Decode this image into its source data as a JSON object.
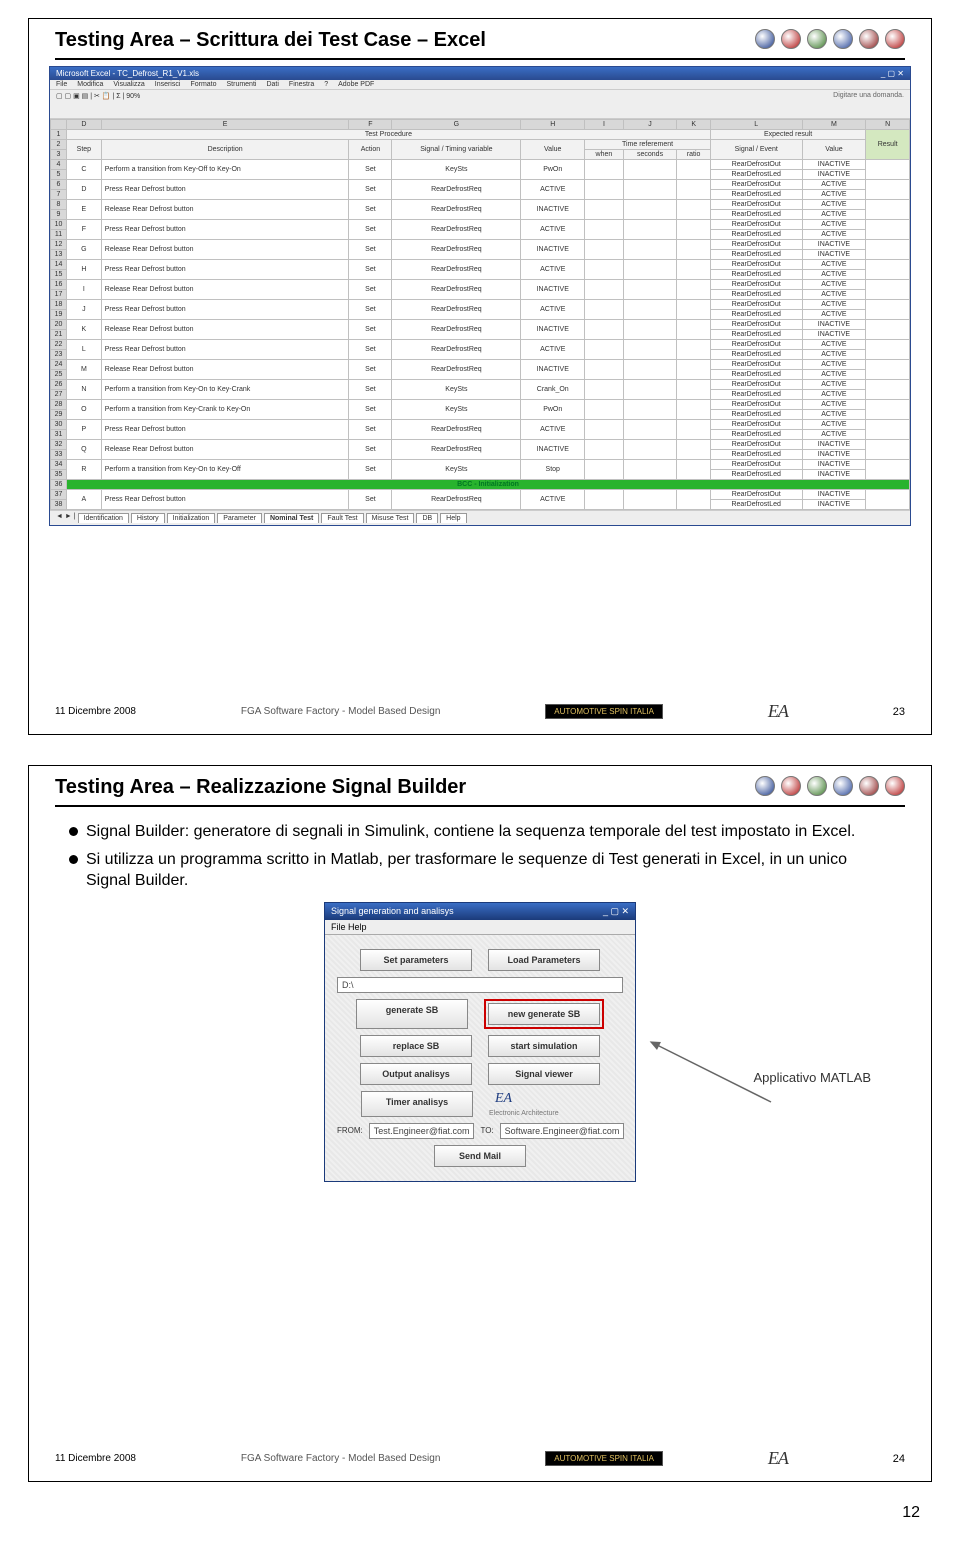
{
  "slide23": {
    "title": "Testing Area – Scrittura dei Test Case – Excel",
    "excel": {
      "window_title": "Microsoft Excel - TC_Defrost_R1_V1.xls",
      "menus": [
        "File",
        "Modifica",
        "Visualizza",
        "Inserisci",
        "Formato",
        "Strumenti",
        "Dati",
        "Finestra",
        "?",
        "Adobe PDF"
      ],
      "question_prompt": "Digitare una domanda.",
      "columns_letters": [
        "D",
        "E",
        "F",
        "G",
        "H",
        "I",
        "J",
        "K",
        "L",
        "M",
        "N"
      ],
      "header1": {
        "test_procedure": "Test Procedure",
        "expected_result": "Expected result",
        "result_col": "Result"
      },
      "header2": {
        "step": "Step",
        "description": "Description",
        "action": "Action",
        "signal_timing": "Signal / Timing variable",
        "value": "Value",
        "time_referement": "Time referement",
        "when": "when",
        "seconds": "seconds",
        "ratio": "ratio",
        "signal_event": "Signal / Event",
        "value2": "Value"
      },
      "expected_pair": [
        {
          "sig": "RearDefrostOut",
          "val": "INACTIVE"
        },
        {
          "sig": "RearDefrostLed",
          "val": "INACTIVE"
        }
      ],
      "expected_active": [
        {
          "sig": "RearDefrostOut",
          "val": "ACTIVE"
        },
        {
          "sig": "RearDefrostLed",
          "val": "ACTIVE"
        }
      ],
      "rows": [
        {
          "step": "C",
          "desc": "Perform a transition from Key-Off to Key-On",
          "action": "Set",
          "sig": "KeySts",
          "val": "PwOn",
          "exp": "inactive"
        },
        {
          "step": "D",
          "desc": "Press Rear Defrost button",
          "action": "Set",
          "sig": "RearDefrostReq",
          "val": "ACTIVE",
          "exp": "active"
        },
        {
          "step": "E",
          "desc": "Release Rear Defrost button",
          "action": "Set",
          "sig": "RearDefrostReq",
          "val": "INACTIVE",
          "exp": "active"
        },
        {
          "step": "F",
          "desc": "Press Rear Defrost button",
          "action": "Set",
          "sig": "RearDefrostReq",
          "val": "ACTIVE",
          "exp": "active"
        },
        {
          "step": "G",
          "desc": "Release Rear Defrost button",
          "action": "Set",
          "sig": "RearDefrostReq",
          "val": "INACTIVE",
          "exp": "inactive"
        },
        {
          "step": "H",
          "desc": "Press Rear Defrost button",
          "action": "Set",
          "sig": "RearDefrostReq",
          "val": "ACTIVE",
          "exp": "active"
        },
        {
          "step": "I",
          "desc": "Release Rear Defrost button",
          "action": "Set",
          "sig": "RearDefrostReq",
          "val": "INACTIVE",
          "exp": "active"
        },
        {
          "step": "J",
          "desc": "Press Rear Defrost button",
          "action": "Set",
          "sig": "RearDefrostReq",
          "val": "ACTIVE",
          "exp": "active"
        },
        {
          "step": "K",
          "desc": "Release Rear Defrost button",
          "action": "Set",
          "sig": "RearDefrostReq",
          "val": "INACTIVE",
          "exp": "inactive"
        },
        {
          "step": "L",
          "desc": "Press Rear Defrost button",
          "action": "Set",
          "sig": "RearDefrostReq",
          "val": "ACTIVE",
          "exp": "active"
        },
        {
          "step": "M",
          "desc": "Release Rear Defrost button",
          "action": "Set",
          "sig": "RearDefrostReq",
          "val": "INACTIVE",
          "exp": "active"
        },
        {
          "step": "N",
          "desc": "Perform a transition from Key-On to Key-Crank",
          "action": "Set",
          "sig": "KeySts",
          "val": "Crank_On",
          "exp": "active"
        },
        {
          "step": "O",
          "desc": "Perform a transition from Key-Crank to Key-On",
          "action": "Set",
          "sig": "KeySts",
          "val": "PwOn",
          "exp": "active"
        },
        {
          "step": "P",
          "desc": "Press Rear Defrost button",
          "action": "Set",
          "sig": "RearDefrostReq",
          "val": "ACTIVE",
          "exp": "active"
        },
        {
          "step": "Q",
          "desc": "Release Rear Defrost button",
          "action": "Set",
          "sig": "RearDefrostReq",
          "val": "INACTIVE",
          "exp": "inactive"
        },
        {
          "step": "R",
          "desc": "Perform a transition from Key-On to Key-Off",
          "action": "Set",
          "sig": "KeySts",
          "val": "Stop",
          "exp": "inactive"
        }
      ],
      "green_section": "BCC - Initialization",
      "row_after_green": {
        "step": "A",
        "desc": "Press Rear Defrost button",
        "action": "Set",
        "sig": "RearDefrostReq",
        "val": "ACTIVE",
        "exp": "inactive"
      },
      "sheet_tabs": [
        "Identification",
        "History",
        "Initialization",
        "Parameter",
        "Nominal Test",
        "Fault Test",
        "Misuse Test",
        "DB",
        "Help"
      ]
    },
    "footer": {
      "date": "11 Dicembre 2008",
      "mid": "FGA Software Factory - Model Based Design",
      "spin": "AUTOMOTIVE SPIN ITALIA",
      "ea": "EA",
      "page": "23"
    }
  },
  "slide24": {
    "title": "Testing Area – Realizzazione Signal Builder",
    "bullets": [
      "Signal Builder: generatore di segnali in Simulink, contiene la sequenza temporale del test impostato in Excel.",
      "Si utilizza un programma scritto in Matlab, per trasformare le sequenze di Test generati in Excel, in un unico Signal Builder."
    ],
    "matlab": {
      "title": "Signal generation and analisys",
      "menus": "File   Help",
      "set_params": "Set parameters",
      "load_params": "Load Parameters",
      "path": "D:\\",
      "generate_sb": "generate SB",
      "new_generate_sb": "new generate SB",
      "replace_sb": "replace SB",
      "start_sim": "start simulation",
      "output_analisys": "Output analisys",
      "signal_viewer": "Signal viewer",
      "timer_analisys": "Timer analisys",
      "ea": "EA",
      "ea_sub": "Electronic Architecture",
      "from_label": "FROM:",
      "to_label": "TO:",
      "from_val": "Test.Engineer@fiat.com",
      "to_val": "Software.Engineer@fiat.com",
      "send_mail": "Send Mail"
    },
    "arrow_label": "Applicativo MATLAB",
    "footer": {
      "date": "11 Dicembre 2008",
      "mid": "FGA Software Factory - Model Based Design",
      "spin": "AUTOMOTIVE SPIN ITALIA",
      "ea": "EA",
      "page": "24"
    }
  },
  "doc_page_number": "12",
  "brand_colors": [
    "#1b3a8a",
    "#b01515",
    "#3a7a2a",
    "#2b4a9a",
    "#8a1f1f",
    "#b01515"
  ]
}
